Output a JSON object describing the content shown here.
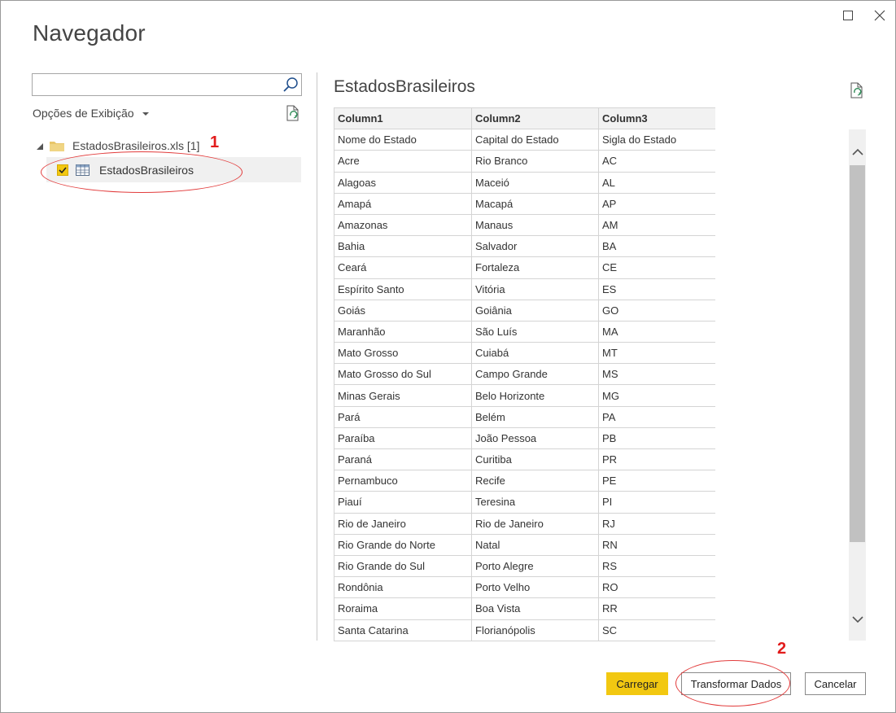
{
  "window": {
    "title": "Navegador"
  },
  "left_panel": {
    "search": {
      "value": "",
      "placeholder": ""
    },
    "view_options_label": "Opções de Exibição",
    "tree": {
      "file_label": "EstadosBrasileiros.xls [1]",
      "items": [
        {
          "label": "EstadosBrasileiros",
          "checked": true
        }
      ]
    }
  },
  "annotations": {
    "marker_1": "1",
    "marker_2": "2"
  },
  "preview": {
    "title": "EstadosBrasileiros",
    "columns": [
      "Column1",
      "Column2",
      "Column3"
    ],
    "rows": [
      [
        "Nome do Estado",
        "Capital do Estado",
        "Sigla do Estado"
      ],
      [
        "Acre",
        "Rio Branco",
        "AC"
      ],
      [
        "Alagoas",
        "Maceió",
        "AL"
      ],
      [
        "Amapá",
        "Macapá",
        "AP"
      ],
      [
        "Amazonas",
        "Manaus",
        "AM"
      ],
      [
        "Bahia",
        "Salvador",
        "BA"
      ],
      [
        "Ceará",
        "Fortaleza",
        "CE"
      ],
      [
        "Espírito Santo",
        "Vitória",
        "ES"
      ],
      [
        "Goiás",
        "Goiânia",
        "GO"
      ],
      [
        "Maranhão",
        "São Luís",
        "MA"
      ],
      [
        "Mato Grosso",
        "Cuiabá",
        "MT"
      ],
      [
        "Mato Grosso do Sul",
        "Campo Grande",
        "MS"
      ],
      [
        "Minas Gerais",
        "Belo Horizonte",
        "MG"
      ],
      [
        "Pará",
        "Belém",
        "PA"
      ],
      [
        "Paraíba",
        "João Pessoa",
        "PB"
      ],
      [
        "Paraná",
        "Curitiba",
        "PR"
      ],
      [
        "Pernambuco",
        "Recife",
        "PE"
      ],
      [
        "Piauí",
        "Teresina",
        "PI"
      ],
      [
        "Rio de Janeiro",
        "Rio de Janeiro",
        "RJ"
      ],
      [
        "Rio Grande do Norte",
        "Natal",
        "RN"
      ],
      [
        "Rio Grande do Sul",
        "Porto Alegre",
        "RS"
      ],
      [
        "Rondônia",
        "Porto Velho",
        "RO"
      ],
      [
        "Roraima",
        "Boa Vista",
        "RR"
      ],
      [
        "Santa Catarina",
        "Florianópolis",
        "SC"
      ]
    ]
  },
  "buttons": {
    "load": "Carregar",
    "transform": "Transformar Dados",
    "cancel": "Cancelar"
  },
  "colors": {
    "accent": "#f2c811",
    "annotation": "#e21c1c"
  },
  "icons": [
    "maximize-icon",
    "close-icon",
    "search-icon",
    "refresh-icon",
    "folder-icon",
    "table-icon",
    "checkmark-icon",
    "chevron-up-icon",
    "chevron-down-icon"
  ]
}
